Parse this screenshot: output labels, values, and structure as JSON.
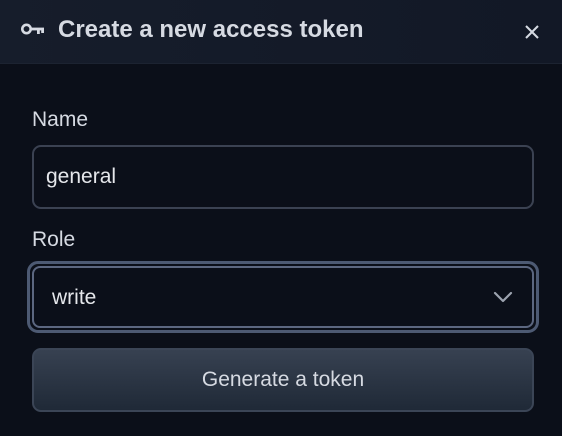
{
  "dialog": {
    "title": "Create a new access token",
    "title_icon": "key-icon",
    "close_icon": "close-icon"
  },
  "form": {
    "name_label": "Name",
    "name_value": "general",
    "role_label": "Role",
    "role_value": "write",
    "role_icon": "chevron-down-icon",
    "submit_label": "Generate a token"
  },
  "colors": {
    "background": "#0b0f19",
    "header": "#161d2b",
    "text": "#d6dae2",
    "border": "#3b4252",
    "focus_ring": "#4d5a73",
    "button": "#374151"
  }
}
